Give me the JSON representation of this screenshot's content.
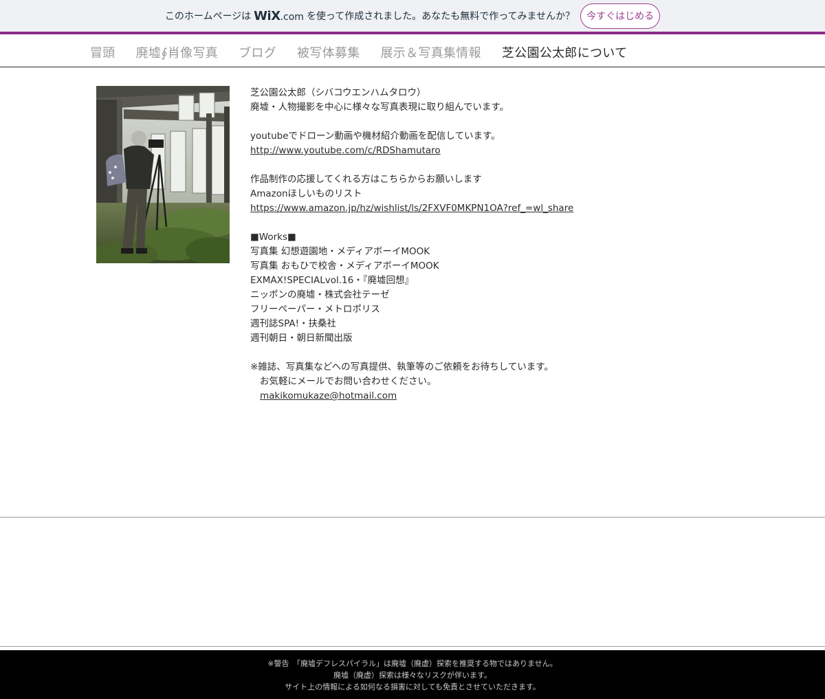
{
  "banner": {
    "pre_text": "このホームページは",
    "logo_text": "WiX",
    "logo_suffix": ".com",
    "post_text": "を使って作成されました。あなたも無料で作ってみませんか？",
    "cta_label": "今すぐはじめる",
    "accent_color": "#9a3f93"
  },
  "nav": {
    "items": [
      {
        "label": "冒頭"
      },
      {
        "label": "廃墟∮肖像写真"
      },
      {
        "label": "ブログ"
      },
      {
        "label": "被写体募集"
      },
      {
        "label": "展示＆写真集情報"
      },
      {
        "label": "芝公園公太郎について"
      }
    ],
    "active_index": 5
  },
  "profile": {
    "name_line": "芝公園公太郎（シバコウエンハムタロウ）",
    "intro_line": "廃墟・人物撮影を中心に様々な写真表現に取り組んでいます。",
    "youtube_line": "youtubeでドローン動画や機材紹介動画を配信しています。",
    "youtube_link": "http://www.youtube.com/c/RDShamutaro",
    "support_line": "作品制作の応援してくれる方はこちらからお願いします",
    "amazon_label": "Amazonほしいものリスト",
    "amazon_link": "https://www.amazon.jp/hz/wishlist/ls/2FXVF0MKPN1OA?ref_=wl_share",
    "works_heading": "■Works■",
    "works": [
      "写真集 幻想遊園地・メディアボーイMOOK",
      "写真集 おもひで校舎・メディアボーイMOOK",
      "EXMAX!SPECIALvol.16・『廃墟回想』",
      "ニッポンの廃墟・株式会社テーゼ",
      "フリーペーパー・メトロポリス",
      "週刊誌SPA!・扶桑社",
      "週刊朝日・朝日新聞出版"
    ],
    "request_line": "※雑誌、写真集などへの写真提供、執筆等のご依頼をお待ちしています。",
    "contact_line": "お気軽にメールでお問い合わせください。",
    "email": "makikomukaze@hotmail.com"
  },
  "footer": {
    "lines": [
      "※警告　「廃墟デフレスパイラル」は廃墟（廃虚）探索を推奨する物ではありません。",
      "廃墟（廃虚）探索は様々なリスクが伴います。",
      "サイト上の情報による如何なる損害に対しても免責とさせていただきます。"
    ]
  }
}
